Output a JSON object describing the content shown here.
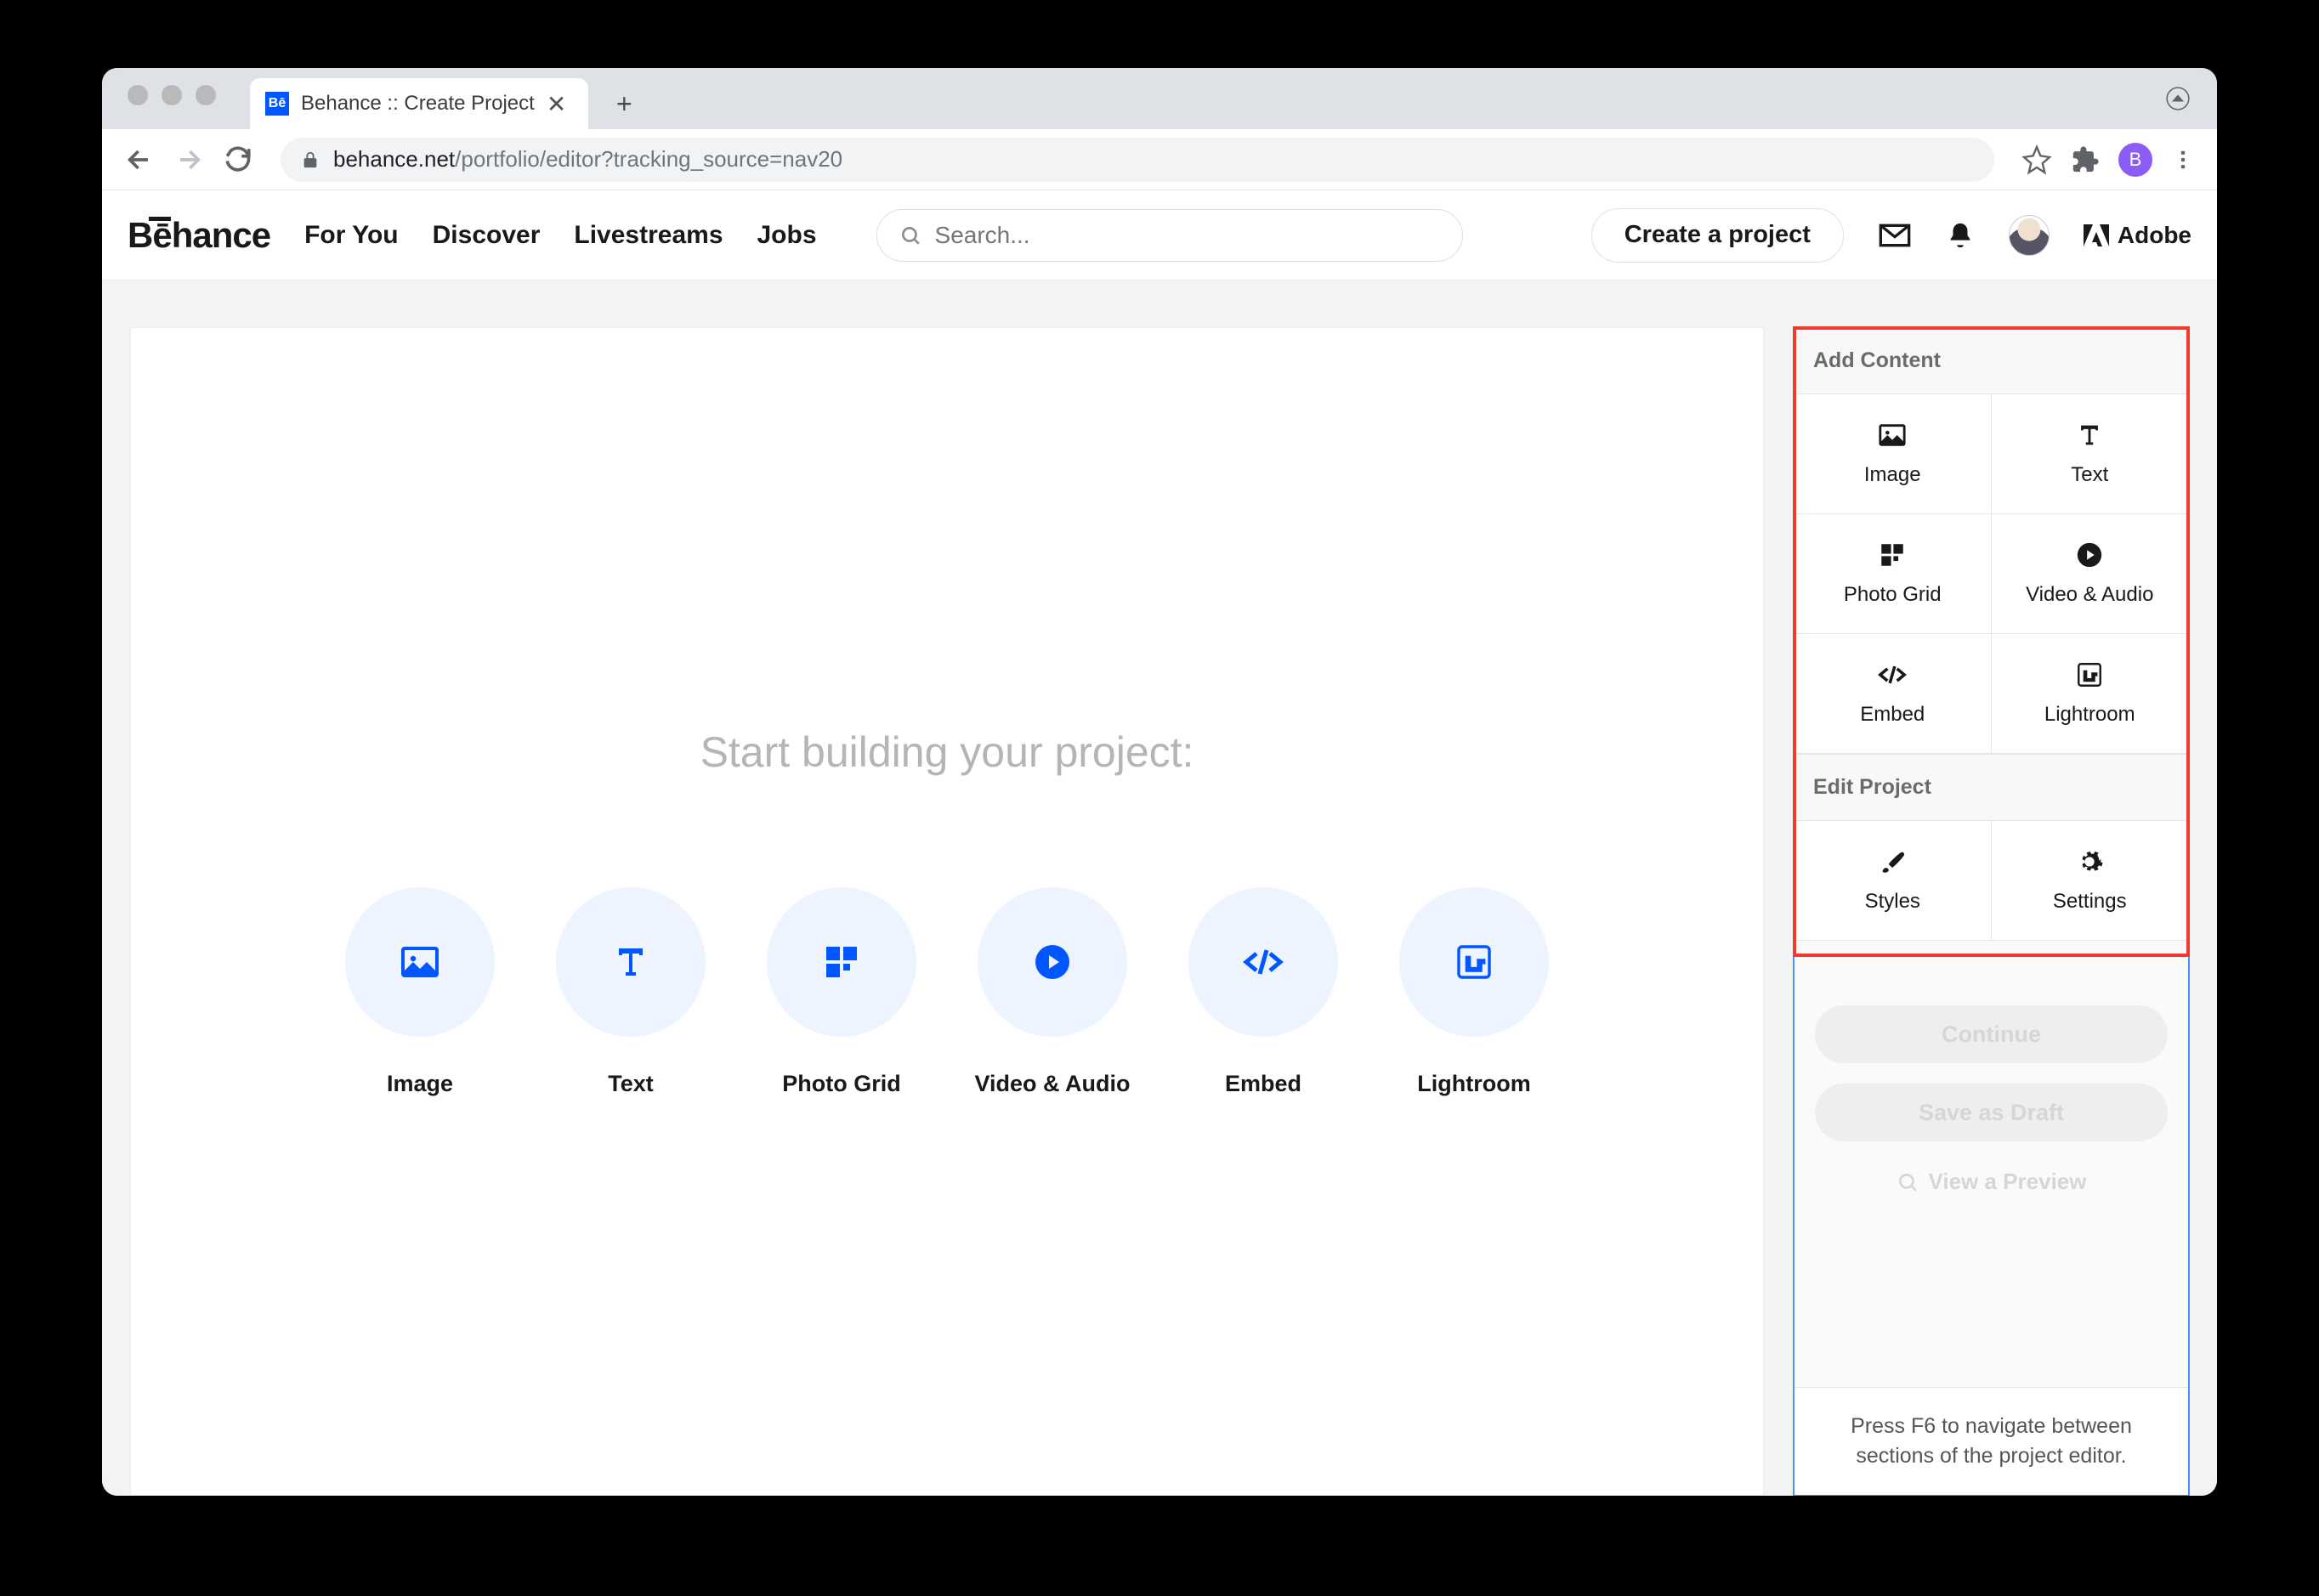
{
  "browser": {
    "tab_title": "Behance :: Create Project",
    "url_domain": "behance.net",
    "url_path": "/portfolio/editor?tracking_source=nav20",
    "profile_initial": "B"
  },
  "topnav": {
    "logo": "Bēhance",
    "links": [
      "For You",
      "Discover",
      "Livestreams",
      "Jobs"
    ],
    "search_placeholder": "Search...",
    "create_label": "Create a project",
    "adobe_label": "Adobe"
  },
  "canvas": {
    "title": "Start building your project:",
    "tiles": [
      "Image",
      "Text",
      "Photo Grid",
      "Video & Audio",
      "Embed",
      "Lightroom"
    ]
  },
  "sidebar": {
    "add_header": "Add Content",
    "add_cells": [
      "Image",
      "Text",
      "Photo Grid",
      "Video & Audio",
      "Embed",
      "Lightroom"
    ],
    "edit_header": "Edit Project",
    "edit_cells": [
      "Styles",
      "Settings"
    ],
    "continue_label": "Continue",
    "draft_label": "Save as Draft",
    "preview_label": "View a Preview",
    "hint": "Press F6 to navigate between sections of the project editor."
  }
}
